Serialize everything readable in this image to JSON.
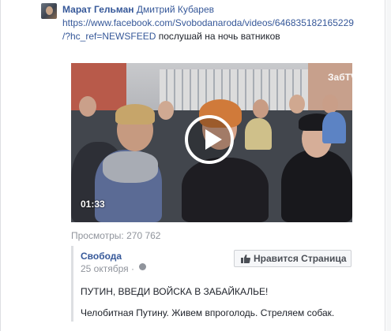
{
  "post": {
    "author": "Марат Гельман",
    "mention": "Дмитрий Кубарев",
    "link_line1": "https://www.facebook.com/Svobodanaroda/videos/646835182165229",
    "link_line2": "/?hc_ref=NEWSFEED",
    "link_tail": " послушай на ночь ватников"
  },
  "video": {
    "watermark": "ЗабTV",
    "duration": "01:33"
  },
  "views": "Просмотры: 270 762",
  "shared": {
    "page_name": "Свобода",
    "date": "25 октября ·",
    "like_button": "Нравится Страница",
    "title": "ПУТИН, ВВЕДИ ВОЙСКА В ЗАБАЙКАЛЬЕ!",
    "text": "Челобитная Путину. Живем впроголодь. Стреляем собак."
  },
  "icons": {
    "play": "play-icon",
    "globe": "globe-icon",
    "like": "thumbs-up-icon"
  },
  "colors": {
    "link": "#365899",
    "muted": "#90949c",
    "text": "#1d2129"
  }
}
